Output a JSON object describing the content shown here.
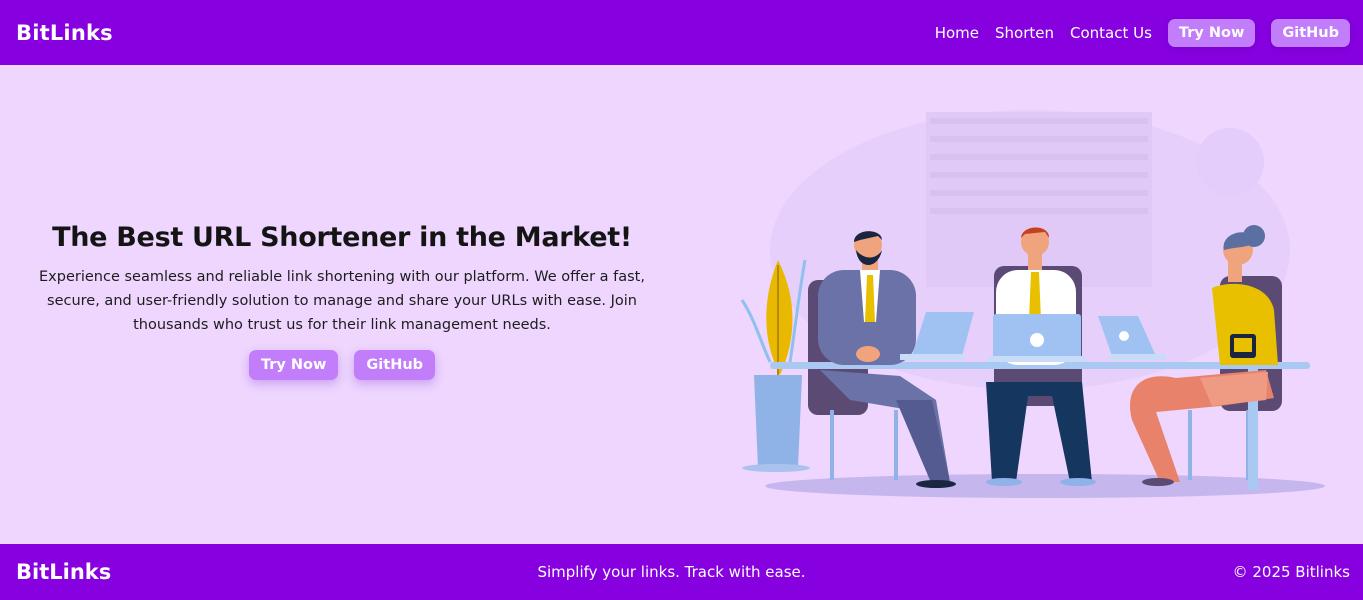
{
  "nav": {
    "brand": "BitLinks",
    "links": [
      "Home",
      "Shorten",
      "Contact Us"
    ],
    "try_now": "Try Now",
    "github": "GitHub"
  },
  "hero": {
    "title": "The Best URL Shortener in the Market!",
    "description": "Experience seamless and reliable link shortening with our platform. We offer a fast, secure, and user-friendly solution to manage and share your URLs with ease. Join thousands who trust us for their link management needs.",
    "try_now": "Try Now",
    "github": "GitHub"
  },
  "footer": {
    "brand": "BitLinks",
    "tagline": "Simplify your links. Track with ease.",
    "copyright": "© 2025 Bitlinks"
  },
  "colors": {
    "primary": "#8600e0",
    "button": "#c27dfa",
    "background": "#eed6ff"
  },
  "illustration": {
    "icon": "team-working-illustration"
  }
}
